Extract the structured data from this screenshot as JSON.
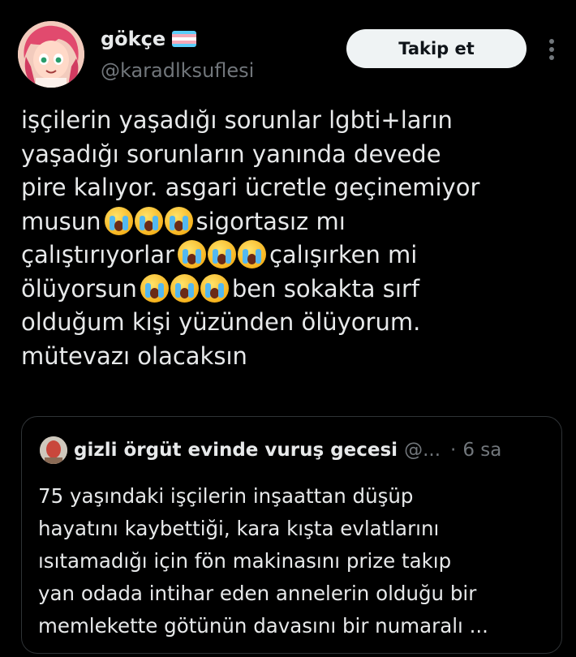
{
  "author": {
    "display_name": "gökçe",
    "handle": "@karadlksuflesi",
    "flag_icon": "transgender-flag-icon",
    "flag_colors": [
      "#5bcefa",
      "#f5a9b8",
      "#ffffff",
      "#f5a9b8",
      "#5bcefa"
    ]
  },
  "actions": {
    "follow_label": "Takip et",
    "more_icon": "more-vertical-icon"
  },
  "tweet": {
    "lines": [
      {
        "text": "işçilerin yaşadığı sorunlar lgbti+ların"
      },
      {
        "text": "yaşadığı sorunların yanında devede"
      },
      {
        "text": "pire kalıyor. asgari ücretle geçinemiyor"
      },
      {
        "text": "musun",
        "emoji_after": "loudly-crying-face-icon",
        "emoji_count": 3,
        "tail": "sigortasız mı"
      },
      {
        "text": "çalıştırıyorlar",
        "emoji_after": "loudly-crying-face-icon",
        "emoji_count": 3,
        "tail": "çalışırken mi"
      },
      {
        "text": "ölüyorsun",
        "emoji_after": "loudly-crying-face-icon",
        "emoji_count": 3,
        "tail": "ben sokakta sırf"
      },
      {
        "text": "olduğum kişi yüzünden ölüyorum."
      },
      {
        "text": "mütevazı olacaksın"
      }
    ]
  },
  "quoted_tweet": {
    "display_name": "gizli örgüt evinde vuruş gecesi",
    "handle": "@...",
    "separator": "·",
    "time": "6 sa",
    "lines": [
      "75 yaşındaki işçilerin inşaattan düşüp",
      "hayatını kaybettiği, kara kışta evlatlarını",
      "ısıtamadığı için fön makinasını prize takıp",
      "yan odada intihar eden annelerin olduğu bir",
      "memlekette götünün davasını bir numaralı ..."
    ]
  },
  "colors": {
    "background": "#000000",
    "text_primary": "#e7e9ea",
    "text_secondary": "#71767b",
    "border": "#2f3336",
    "button_bg": "#eff3f4"
  }
}
